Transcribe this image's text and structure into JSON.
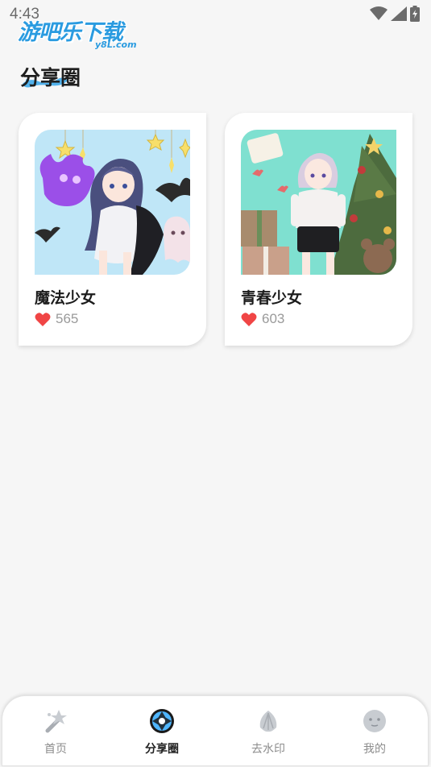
{
  "status_bar": {
    "time": "4:43",
    "icons": [
      "wifi-icon",
      "cell-signal-icon",
      "battery-icon"
    ]
  },
  "watermark": {
    "title": "游吧乐下载",
    "subtitle": "y8L.com"
  },
  "page": {
    "title": "分享圈"
  },
  "cards": [
    {
      "title": "魔法少女",
      "likes": "565"
    },
    {
      "title": "青春少女",
      "likes": "603"
    }
  ],
  "nav": {
    "items": [
      {
        "label": "首页",
        "icon": "wand-icon",
        "active": false
      },
      {
        "label": "分享圈",
        "icon": "aperture-icon",
        "active": true
      },
      {
        "label": "去水印",
        "icon": "shell-icon",
        "active": false
      },
      {
        "label": "我的",
        "icon": "face-icon",
        "active": false
      }
    ]
  },
  "colors": {
    "accent": "#2a9be0",
    "like": "#f04545",
    "background": "#f6f6f6"
  }
}
